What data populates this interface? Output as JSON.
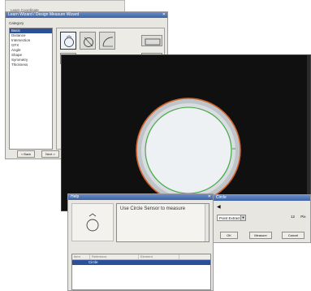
{
  "back_window": {
    "title": "Learn Coordinate"
  },
  "wizard": {
    "title": "Learn Wizard / Design Measure Wizard",
    "category_label": "Category",
    "categories": [
      {
        "label": "Basic",
        "selected": true
      },
      {
        "label": "Distance",
        "selected": false
      },
      {
        "label": "Intersection",
        "selected": false
      },
      {
        "label": "GFX",
        "selected": false
      },
      {
        "label": "Angle",
        "selected": false
      },
      {
        "label": "Shape",
        "selected": false
      },
      {
        "label": "Symmetry",
        "selected": false
      },
      {
        "label": "Thickness",
        "selected": false
      }
    ],
    "buttons": {
      "back": "< Back",
      "next": "Next >"
    }
  },
  "help": {
    "title": "Help",
    "text": "Use Circle Sensor to measure",
    "list_headers": [
      "Item",
      "Reference",
      "Element"
    ],
    "list_rows": [
      {
        "label": "Circle"
      }
    ]
  },
  "dialog": {
    "title": "Circle",
    "combo_value": "Point Extract",
    "value": "12",
    "unit": "Pix",
    "buttons": {
      "ok": "OK",
      "measure": "Measure",
      "cancel": "Cancel"
    }
  },
  "colors": {
    "ring_orange": "#d4632a",
    "ring_green": "#3fa83a",
    "selection": "#2c4f9a"
  }
}
